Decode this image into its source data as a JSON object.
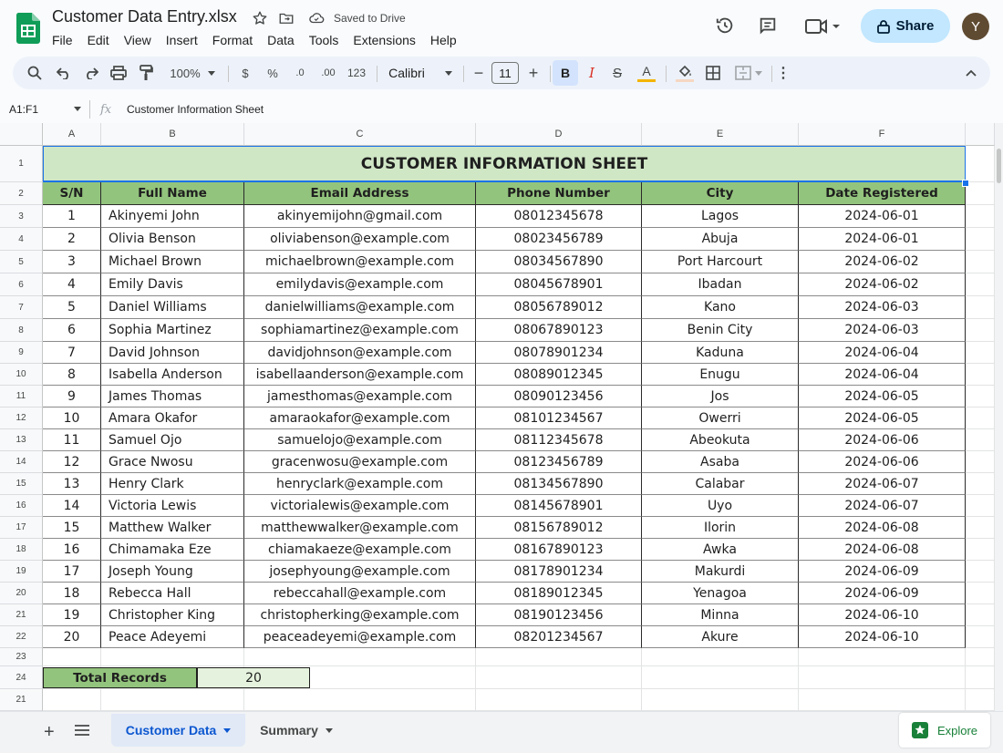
{
  "app": {
    "doc_title": "Customer Data Entry.xlsx",
    "saved_status": "Saved to Drive",
    "menu": [
      "File",
      "Edit",
      "View",
      "Insert",
      "Format",
      "Data",
      "Tools",
      "Extensions",
      "Help"
    ],
    "share_label": "Share",
    "avatar_initial": "Y"
  },
  "toolbar": {
    "zoom": "100%",
    "currency": "$",
    "percent": "%",
    "dec_decrease": ".0",
    "dec_increase": ".00",
    "number_format": "123",
    "font": "Calibri",
    "font_size": "11",
    "bold": "B",
    "italic": "I",
    "strike": "S",
    "text_color": "A"
  },
  "formula_bar": {
    "name_box": "A1:F1",
    "fx": "fx",
    "content": "Customer Information Sheet"
  },
  "columns": [
    "A",
    "B",
    "C",
    "D",
    "E",
    "F"
  ],
  "sheet": {
    "title": "CUSTOMER INFORMATION SHEET",
    "headers": [
      "S/N",
      "Full Name",
      "Email Address",
      "Phone Number",
      "City",
      "Date Registered"
    ],
    "rows": [
      [
        "1",
        "Akinyemi John",
        "akinyemijohn@gmail.com",
        "08012345678",
        "Lagos",
        "2024-06-01"
      ],
      [
        "2",
        "Olivia Benson",
        "oliviabenson@example.com",
        "08023456789",
        "Abuja",
        "2024-06-01"
      ],
      [
        "3",
        "Michael Brown",
        "michaelbrown@example.com",
        "08034567890",
        "Port Harcourt",
        "2024-06-02"
      ],
      [
        "4",
        "Emily Davis",
        "emilydavis@example.com",
        "08045678901",
        "Ibadan",
        "2024-06-02"
      ],
      [
        "5",
        "Daniel Williams",
        "danielwilliams@example.com",
        "08056789012",
        "Kano",
        "2024-06-03"
      ],
      [
        "6",
        "Sophia Martinez",
        "sophiamartinez@example.com",
        "08067890123",
        "Benin City",
        "2024-06-03"
      ],
      [
        "7",
        "David Johnson",
        "davidjohnson@example.com",
        "08078901234",
        "Kaduna",
        "2024-06-04"
      ],
      [
        "8",
        "Isabella Anderson",
        "isabellaanderson@example.com",
        "08089012345",
        "Enugu",
        "2024-06-04"
      ],
      [
        "9",
        "James Thomas",
        "jamesthomas@example.com",
        "08090123456",
        "Jos",
        "2024-06-05"
      ],
      [
        "10",
        "Amara Okafor",
        "amaraokafor@example.com",
        "08101234567",
        "Owerri",
        "2024-06-05"
      ],
      [
        "11",
        "Samuel Ojo",
        "samuelojo@example.com",
        "08112345678",
        "Abeokuta",
        "2024-06-06"
      ],
      [
        "12",
        "Grace Nwosu",
        "gracenwosu@example.com",
        "08123456789",
        "Asaba",
        "2024-06-06"
      ],
      [
        "13",
        "Henry Clark",
        "henryclark@example.com",
        "08134567890",
        "Calabar",
        "2024-06-07"
      ],
      [
        "14",
        "Victoria Lewis",
        "victorialewis@example.com",
        "08145678901",
        "Uyo",
        "2024-06-07"
      ],
      [
        "15",
        "Matthew Walker",
        "matthewwalker@example.com",
        "08156789012",
        "Ilorin",
        "2024-06-08"
      ],
      [
        "16",
        "Chimamaka Eze",
        "chiamakaeze@example.com",
        "08167890123",
        "Awka",
        "2024-06-08"
      ],
      [
        "17",
        "Joseph Young",
        "josephyoung@example.com",
        "08178901234",
        "Makurdi",
        "2024-06-09"
      ],
      [
        "18",
        "Rebecca Hall",
        "rebeccahall@example.com",
        "08189012345",
        "Yenagoa",
        "2024-06-09"
      ],
      [
        "19",
        "Christopher King",
        "christopherking@example.com",
        "08190123456",
        "Minna",
        "2024-06-10"
      ],
      [
        "20",
        "Peace Adeyemi",
        "peaceadeyemi@example.com",
        "08201234567",
        "Akure",
        "2024-06-10"
      ]
    ],
    "total_label": "Total Records",
    "total_value": "20",
    "row_numbers": [
      "1",
      "2",
      "3",
      "4",
      "5",
      "6",
      "7",
      "8",
      "9",
      "10",
      "11",
      "12",
      "13",
      "14",
      "15",
      "16",
      "17",
      "18",
      "19",
      "20",
      "21",
      "22",
      "23",
      "24",
      "21"
    ]
  },
  "tabs": [
    {
      "label": "Customer Data",
      "active": true
    },
    {
      "label": "Summary",
      "active": false
    }
  ],
  "explore_label": "Explore",
  "colors": {
    "header_green": "#93c47d",
    "title_green": "#d0e7c6",
    "selection_blue": "#1a73e8",
    "share_bg": "#c2e7ff"
  }
}
